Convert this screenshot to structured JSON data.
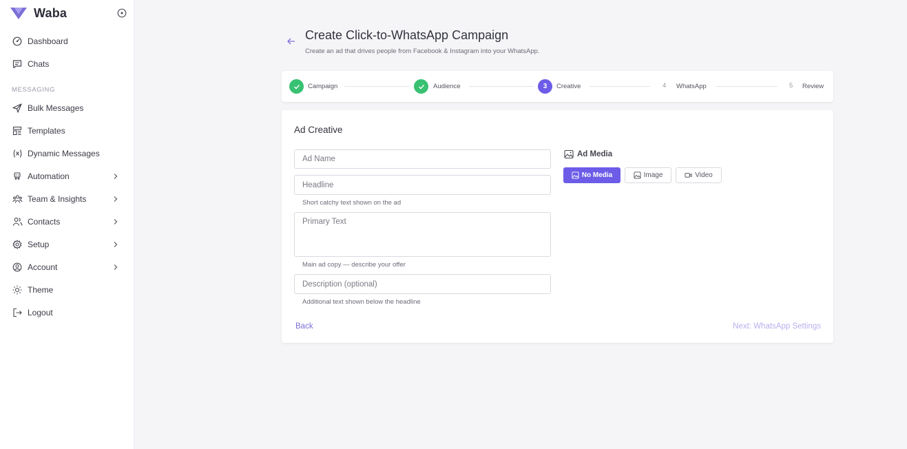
{
  "brand": {
    "name": "Waba",
    "logo_color": "#7c6fd8"
  },
  "sidebar": {
    "items_top": [
      {
        "label": "Dashboard",
        "icon": "dashboard-icon"
      },
      {
        "label": "Chats",
        "icon": "chat-icon"
      }
    ],
    "section_label": "MESSAGING",
    "items": [
      {
        "label": "Bulk Messages",
        "icon": "send-icon"
      },
      {
        "label": "Templates",
        "icon": "templates-icon"
      },
      {
        "label": "Dynamic Messages",
        "icon": "variable-icon"
      },
      {
        "label": "Automation",
        "icon": "robot-icon",
        "expandable": true
      },
      {
        "label": "Team & Insights",
        "icon": "team-icon",
        "expandable": true
      },
      {
        "label": "Contacts",
        "icon": "contacts-icon",
        "expandable": true
      },
      {
        "label": "Setup",
        "icon": "gear-icon",
        "expandable": true
      },
      {
        "label": "Account",
        "icon": "user-circle-icon",
        "expandable": true
      },
      {
        "label": "Theme",
        "icon": "sun-icon"
      },
      {
        "label": "Logout",
        "icon": "logout-icon"
      }
    ]
  },
  "header": {
    "title": "Create Click-to-WhatsApp Campaign",
    "subtitle": "Create an ad that drives people from Facebook & Instagram into your WhatsApp."
  },
  "stepper": {
    "steps": [
      {
        "number": "1",
        "label": "Campaign",
        "status": "done"
      },
      {
        "number": "2",
        "label": "Audience",
        "status": "done"
      },
      {
        "number": "3",
        "label": "Creative",
        "status": "active"
      },
      {
        "number": "4",
        "label": "WhatsApp",
        "status": "pending"
      },
      {
        "number": "5",
        "label": "Review",
        "status": "pending"
      }
    ]
  },
  "creative": {
    "title": "Ad Creative",
    "ad_name_placeholder": "Ad Name",
    "headline_placeholder": "Headline",
    "headline_hint": "Short catchy text shown on the ad",
    "primary_text_placeholder": "Primary Text",
    "primary_text_hint": "Main ad copy — describe your offer",
    "description_placeholder": "Description (optional)",
    "description_hint": "Additional text shown below the headline",
    "media_label": "Ad Media",
    "media_options": [
      {
        "label": "No Media",
        "icon": "no-media-icon",
        "selected": true
      },
      {
        "label": "Image",
        "icon": "image-icon",
        "selected": false
      },
      {
        "label": "Video",
        "icon": "video-icon",
        "selected": false
      }
    ],
    "back_label": "Back",
    "next_label": "Next: WhatsApp Settings"
  },
  "colors": {
    "accent": "#6c5ce7",
    "success": "#38c172",
    "background": "#f5f5f8"
  }
}
